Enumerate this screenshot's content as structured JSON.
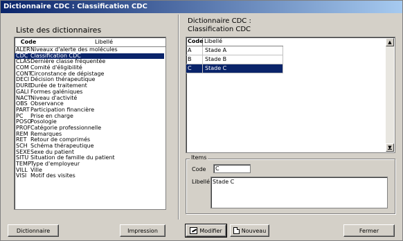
{
  "window": {
    "title": "Dictionnaire CDC : Classification CDC"
  },
  "left": {
    "heading": "Liste des dictionnaires",
    "columns": {
      "code": "Code",
      "libelle": "Libellé"
    },
    "rows": [
      {
        "code": "ALER",
        "libelle": "Niveaux d'alerte des molécules"
      },
      {
        "code": "CDC",
        "libelle": "Classification CDC",
        "selected": true
      },
      {
        "code": "CLAS",
        "libelle": "Dernière classe fréquentée"
      },
      {
        "code": "COM",
        "libelle": "Comité d'éligibilité"
      },
      {
        "code": "CONT",
        "libelle": "Circonstance de dépistage"
      },
      {
        "code": "DECI",
        "libelle": "Décision thérapeutique"
      },
      {
        "code": "DURE",
        "libelle": "Durée de traitement"
      },
      {
        "code": "GALI",
        "libelle": "Formes galéniques"
      },
      {
        "code": "NACT",
        "libelle": "Niveau d'activité"
      },
      {
        "code": "OBS",
        "libelle": "Observance"
      },
      {
        "code": "PART",
        "libelle": "Participation financière"
      },
      {
        "code": "PC",
        "libelle": "Prise en charge"
      },
      {
        "code": "POSO",
        "libelle": "Posologie"
      },
      {
        "code": "PROF",
        "libelle": "Catégorie professionnelle"
      },
      {
        "code": "REM",
        "libelle": "Remarques"
      },
      {
        "code": "RET",
        "libelle": "Retour de comprimés"
      },
      {
        "code": "SCH",
        "libelle": "Schéma thérapeutique"
      },
      {
        "code": "SEXE",
        "libelle": "Sexe du patient"
      },
      {
        "code": "SITU",
        "libelle": "Situation de famille du patient"
      },
      {
        "code": "TEMP",
        "libelle": "Type d'employeur"
      },
      {
        "code": "VILL",
        "libelle": "Ville"
      },
      {
        "code": "VISI",
        "libelle": "Motif des visites"
      }
    ]
  },
  "right": {
    "heading_line1": "Dictionnaire CDC :",
    "heading_line2": "Classification CDC",
    "columns": {
      "code": "Code",
      "libelle": "Libellé"
    },
    "rows": [
      {
        "code": "A",
        "libelle": "Stade A"
      },
      {
        "code": "B",
        "libelle": "Stade B"
      },
      {
        "code": "C",
        "libelle": "Stade C",
        "selected": true
      }
    ],
    "items": {
      "legend": "Items",
      "code_label": "Code",
      "code_value": "C",
      "libelle_label": "Libellé",
      "libelle_value": "Stade C"
    }
  },
  "buttons": {
    "dictionnaire": "Dictionnaire",
    "impression": "Impression",
    "modifier": "Modifier",
    "nouveau": "Nouveau",
    "fermer": "Fermer"
  }
}
